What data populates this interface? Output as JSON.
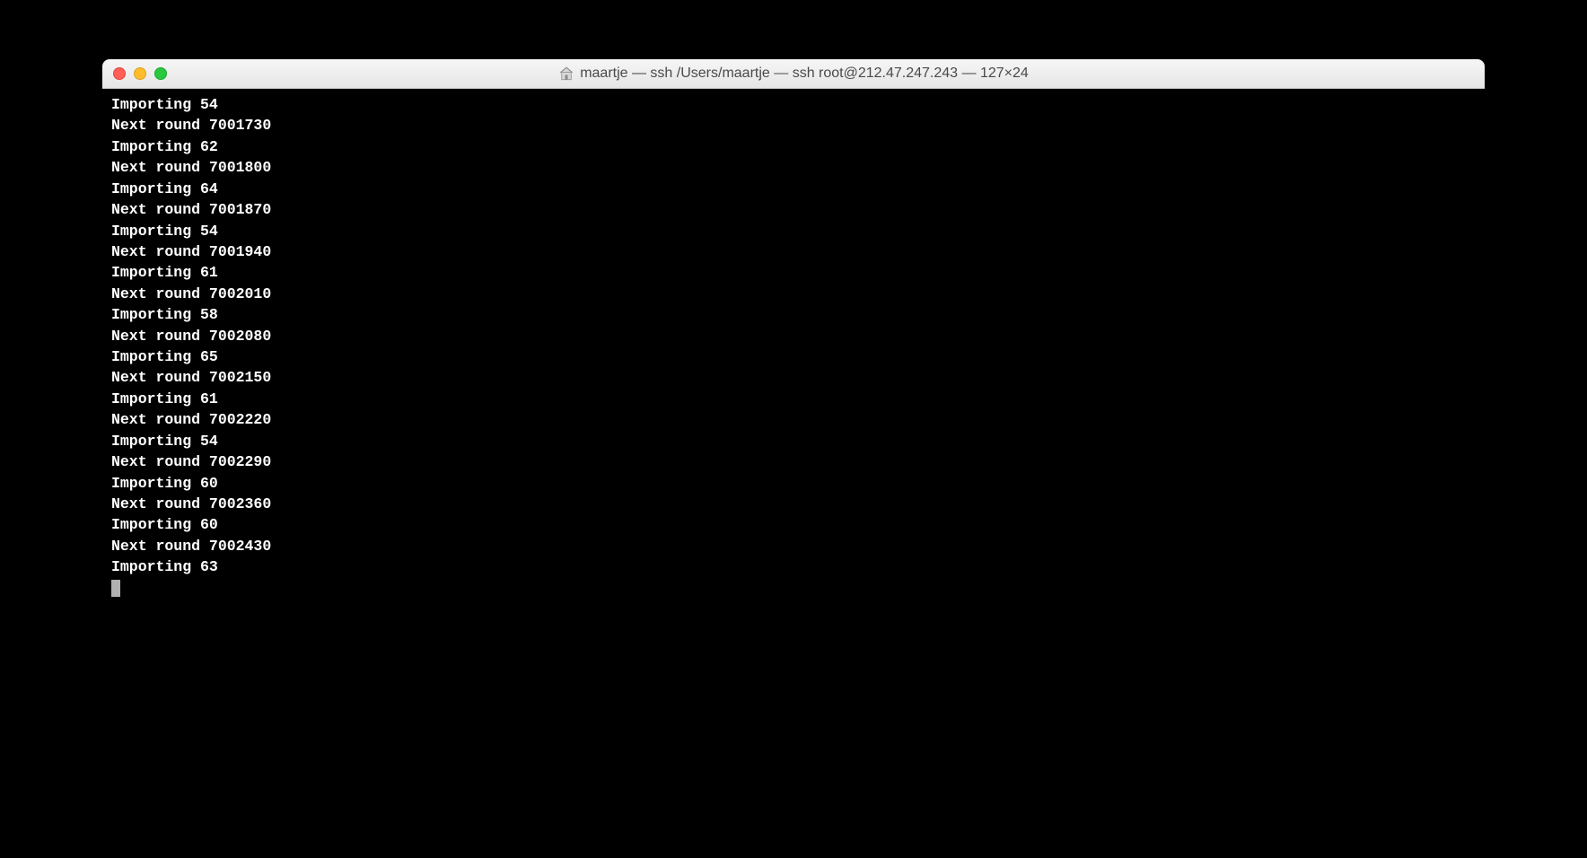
{
  "window": {
    "title": "maartje — ssh  /Users/maartje — ssh root@212.47.247.243 — 127×24"
  },
  "terminal": {
    "lines": [
      "Importing 54",
      "Next round 7001730",
      "Importing 62",
      "Next round 7001800",
      "Importing 64",
      "Next round 7001870",
      "Importing 54",
      "Next round 7001940",
      "Importing 61",
      "Next round 7002010",
      "Importing 58",
      "Next round 7002080",
      "Importing 65",
      "Next round 7002150",
      "Importing 61",
      "Next round 7002220",
      "Importing 54",
      "Next round 7002290",
      "Importing 60",
      "Next round 7002360",
      "Importing 60",
      "Next round 7002430",
      "Importing 63"
    ]
  }
}
